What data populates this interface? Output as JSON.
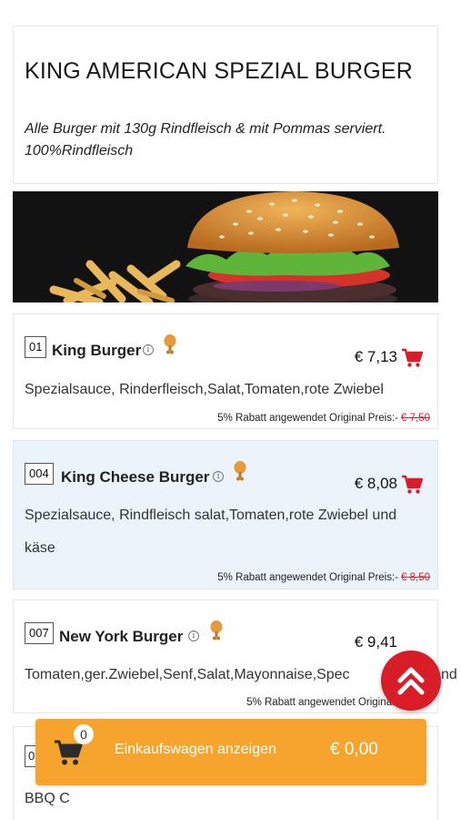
{
  "category": {
    "title": "KING AMERICAN SPEZIAL BURGER",
    "subtitle": "Alle Burger mit 130g Rindfleisch & mit Pommas serviert. 100%Rindfleisch"
  },
  "banner": {
    "icon": "burger-photo"
  },
  "items": [
    {
      "number": "01",
      "name": "King Burger",
      "price": "€ 7,13",
      "description": "Spezialsauce, Rinderfleisch,Salat,Tomaten,rote Zwiebel",
      "discount_text": "5% Rabatt angewendet Original Preis:-",
      "original_price": "€ 7,50"
    },
    {
      "number": "004",
      "name": "King Cheese Burger",
      "price": "€ 8,08",
      "description": "Spezialsauce, Rindfleisch salat,Tomaten,rote Zwiebel und käse",
      "discount_text": "5% Rabatt angewendet Original Preis:-",
      "original_price": "€ 8,50"
    },
    {
      "number": "007",
      "name": "New York Burger",
      "price": "€ 9,41",
      "description": "Tomaten,ger.Zwiebel,Senf,Salat,Mayonnaise,Spec",
      "description_tail": "nd",
      "discount_text": "5% Rabatt angewendet Original Preis:-",
      "original_price": ""
    }
  ],
  "partial_item": {
    "number": "0",
    "name_fragment": "BBQ C"
  },
  "cart": {
    "count": "0",
    "label": "Einkaufswagen anzeigen",
    "total": "€ 0,00"
  },
  "colors": {
    "accent_red": "#d81d28",
    "cart_orange": "#f7a42f",
    "highlight_bg": "#eaf4fa"
  }
}
